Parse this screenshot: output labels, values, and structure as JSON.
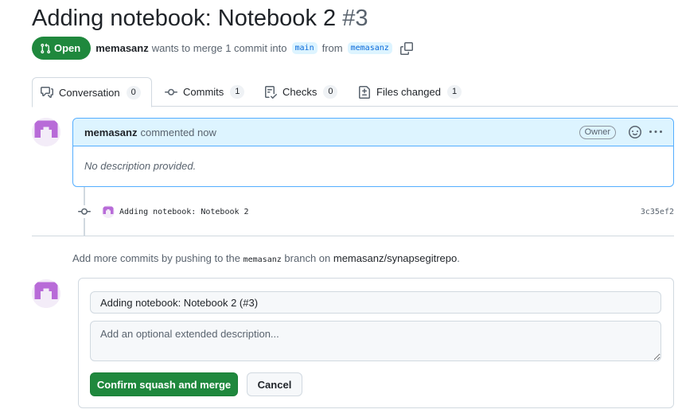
{
  "pr": {
    "title": "Adding notebook: Notebook 2",
    "number": "#3",
    "state": "Open",
    "author": "memasanz",
    "summary": "wants to merge 1 commit into",
    "base_branch": "main",
    "from_word": "from",
    "head_branch": "memasanz"
  },
  "tabs": [
    {
      "label": "Conversation",
      "count": "0",
      "icon": "comment-discussion-icon"
    },
    {
      "label": "Commits",
      "count": "1",
      "icon": "git-commit-icon"
    },
    {
      "label": "Checks",
      "count": "0",
      "icon": "checklist-icon"
    },
    {
      "label": "Files changed",
      "count": "1",
      "icon": "file-diff-icon"
    }
  ],
  "comment": {
    "author": "memasanz",
    "time": "commented now",
    "badge": "Owner",
    "body": "No description provided."
  },
  "commit": {
    "message": "Adding notebook: Notebook 2",
    "sha": "3c35ef2"
  },
  "push_hint": {
    "prefix": "Add more commits by pushing to the",
    "branch": "memasanz",
    "middle": "branch on",
    "repo": "memasanz/synapsegitrepo",
    "suffix": "."
  },
  "merge": {
    "title_value": "Adding notebook: Notebook 2 (#3)",
    "description_placeholder": "Add an optional extended description...",
    "confirm_label": "Confirm squash and merge",
    "cancel_label": "Cancel"
  },
  "colors": {
    "accent_green": "#1f883d",
    "link_blue": "#0969da",
    "header_blue": "#ddf4ff",
    "avatar_purple": "#b86bd8"
  }
}
